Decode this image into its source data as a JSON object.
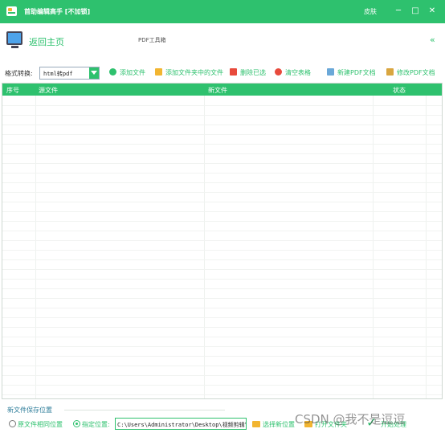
{
  "window": {
    "title": "首助编辑高手 [不加锁]",
    "skin": "皮肤",
    "minimize": "─",
    "maximize": "□",
    "close": "✕"
  },
  "header": {
    "home": "返回主页",
    "toolbox": "PDF工具箱",
    "collapse": "«"
  },
  "toolbar": {
    "format_label": "格式转换:",
    "format_value": "html转pdf",
    "add_file": "添加文件",
    "add_folder_files": "添加文件夹中的文件",
    "delete_selected": "删除已选",
    "clear_table": "清空表格",
    "new_pdf": "新建PDF文档",
    "edit_pdf": "修改PDF文档"
  },
  "table": {
    "columns": [
      "序号",
      "源文件",
      "新文件",
      "状态"
    ],
    "rows": []
  },
  "footer": {
    "save_location_label": "新文件保存位置",
    "radio_same": "原文件相同位置",
    "radio_specified": "指定位置:",
    "path": "C:\\Users\\Administrator\\Desktop\\视频剪辑\\",
    "choose_location": "选择新位置",
    "open_folder": "打开文件夹",
    "start": "开始处理"
  },
  "watermark": "CSDN @我不是逗逗",
  "colors": {
    "accent": "#2ec16e",
    "link_blue": "#2e7d9a"
  }
}
